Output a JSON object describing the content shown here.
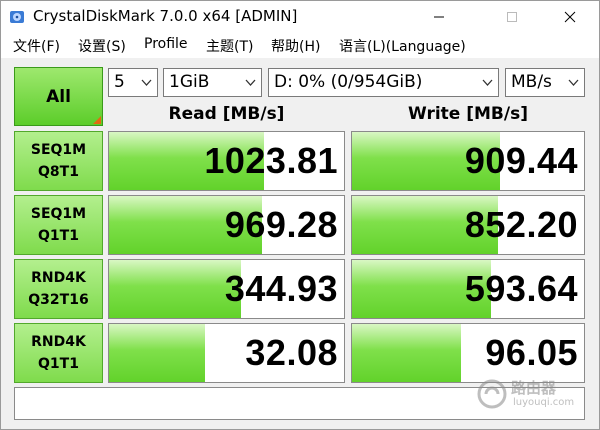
{
  "window": {
    "title": "CrystalDiskMark 7.0.0 x64 [ADMIN]"
  },
  "menu": {
    "items": [
      {
        "label": "文件(F)"
      },
      {
        "label": "设置(S)"
      },
      {
        "label": "Profile"
      },
      {
        "label": "主题(T)"
      },
      {
        "label": "帮助(H)"
      },
      {
        "label": "语言(L)(Language)"
      }
    ]
  },
  "toolbar": {
    "all_label": "All",
    "count": "5",
    "size": "1GiB",
    "drive": "D: 0% (0/954GiB)",
    "unit": "MB/s"
  },
  "headers": {
    "read": "Read [MB/s]",
    "write": "Write [MB/s]"
  },
  "rows": [
    {
      "line1": "SEQ1M",
      "line2": "Q8T1",
      "read": "1023.81",
      "write": "909.44",
      "read_fill": 0.66,
      "write_fill": 0.64
    },
    {
      "line1": "SEQ1M",
      "line2": "Q1T1",
      "read": "969.28",
      "write": "852.20",
      "read_fill": 0.65,
      "write_fill": 0.63
    },
    {
      "line1": "RND4K",
      "line2": "Q32T16",
      "read": "344.93",
      "write": "593.64",
      "read_fill": 0.56,
      "write_fill": 0.6
    },
    {
      "line1": "RND4K",
      "line2": "Q1T1",
      "read": "32.08",
      "write": "96.05",
      "read_fill": 0.41,
      "write_fill": 0.47
    }
  ],
  "status": "",
  "watermark": {
    "line1": "路由器",
    "line2": "luyouqi.com"
  },
  "colors": {
    "accent_green": "#5ccd2a",
    "corner_orange": "#e26a12"
  },
  "icons": {
    "app": "disk-icon",
    "minimize": "minimize-icon",
    "maximize": "maximize-icon",
    "close": "close-icon",
    "dropdown": "chevron-down-icon"
  }
}
